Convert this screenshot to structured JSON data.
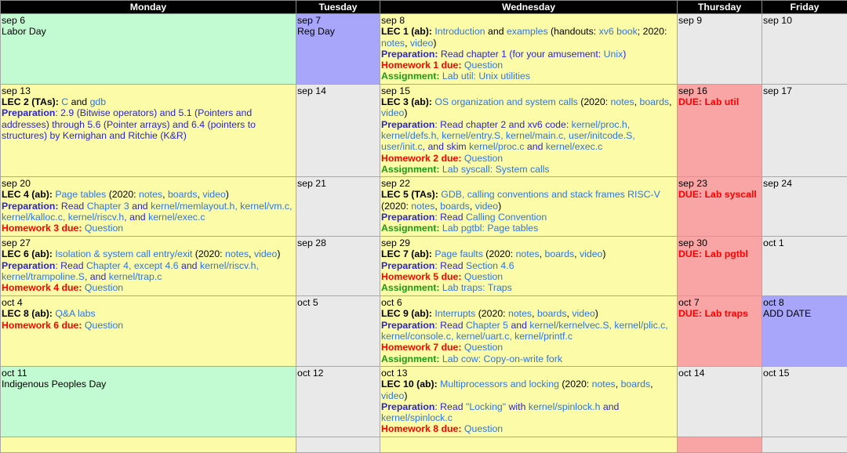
{
  "headers": [
    "Monday",
    "Tuesday",
    "Wednesday",
    "Thursday",
    "Friday"
  ],
  "weeks": [
    {
      "mon": {
        "date": "sep 6",
        "text": "Labor Day"
      },
      "tue": {
        "date": "sep 7",
        "text": "Reg Day"
      },
      "wed": {
        "date": "sep 8",
        "lec_label": "LEC 1 (ab):",
        "lec_link1": "Introduction",
        "lec_and": "and",
        "lec_link2": "examples",
        "lec_mid": "(handouts:",
        "lec_link3": "xv6 book",
        "lec_mid2": "; 2020:",
        "lec_link4": "notes",
        "lec_link5": "video",
        "lec_close": ")",
        "prep_label": "Preparation:",
        "prep_text": "Read chapter 1 (for your amusement:",
        "prep_link": "Unix",
        "prep_close": ")",
        "hw_label": "Homework 1 due:",
        "hw_link": "Question",
        "asg_label": "Assignment:",
        "asg_link": "Lab util: Unix utilities"
      },
      "thu": {
        "date": "sep 9"
      },
      "fri": {
        "date": "sep 10"
      }
    },
    {
      "mon": {
        "date": "sep 13",
        "lec_label": "LEC 2 (TAs):",
        "lec_link1": "C",
        "lec_and": "and",
        "lec_link2": "gdb",
        "prep_label": "Preparation",
        "prep_text": ": 2.9 (Bitwise operators) and 5.1 (Pointers and addresses) through 5.6 (Pointer arrays) and 6.4 (pointers to structures) by Kernighan and Ritchie (K&R)"
      },
      "tue": {
        "date": "sep 14"
      },
      "wed": {
        "date": "sep 15",
        "lec_label": "LEC 3 (ab):",
        "lec_link1": "OS organization and system calls",
        "lec_mid": "(2020:",
        "lec_link2": "notes",
        "lec_link3": "boards",
        "lec_link4": "video",
        "lec_close": ")",
        "prep_label": "Preparation",
        "prep_text": ": Read chapter 2 and xv6 code:",
        "prep_files": "kernel/proc.h, kernel/defs.h, kernel/entry.S, kernel/main.c, user/initcode.S, user/init.c",
        "prep_and_skim": ", and skim",
        "prep_file2": "kernel/proc.c",
        "prep_and": "and",
        "prep_file3": "kernel/exec.c",
        "hw_label": "Homework 2 due:",
        "hw_link": "Question",
        "asg_label": "Assignment:",
        "asg_link": "Lab syscall: System calls"
      },
      "thu": {
        "date": "sep 16",
        "due_label": "DUE:",
        "due_link": "Lab util"
      },
      "fri": {
        "date": "sep 17"
      }
    },
    {
      "mon": {
        "date": "sep 20",
        "lec_label": "LEC 4 (ab):",
        "lec_link1": "Page tables",
        "lec_mid": "(2020:",
        "lec_link2": "notes",
        "lec_link3": "boards",
        "lec_link4": "video",
        "lec_close": ")",
        "prep_label": "Preparation:",
        "prep_text": "Read",
        "prep_link1": "Chapter 3",
        "prep_and": "and",
        "prep_files": "kernel/memlayout.h, kernel/vm.c, kernel/kalloc.c, kernel/riscv.h",
        "prep_and2": ", and",
        "prep_file2": "kernel/exec.c",
        "hw_label": "Homework 3 due:",
        "hw_link": "Question"
      },
      "tue": {
        "date": "sep 21"
      },
      "wed": {
        "date": "sep 22",
        "lec_label": "LEC 5 (TAs):",
        "lec_link1": "GDB, calling conventions and stack frames RISC-V",
        "lec_mid": "(2020:",
        "lec_link2": "notes",
        "lec_link3": "boards",
        "lec_link4": "video",
        "lec_close": ")",
        "prep_label": "Preparation",
        "prep_text": ": Read",
        "prep_link": "Calling Convention",
        "asg_label": "Assignment:",
        "asg_link": "Lab pgtbl: Page tables"
      },
      "thu": {
        "date": "sep 23",
        "due_label": "DUE:",
        "due_link": "Lab syscall"
      },
      "fri": {
        "date": "sep 24"
      }
    },
    {
      "mon": {
        "date": "sep 27",
        "lec_label": "LEC 6 (ab):",
        "lec_link1": "Isolation & system call entry/exit",
        "lec_mid": "(2020:",
        "lec_link2": "notes",
        "lec_link3": "video",
        "lec_close": ")",
        "prep_label": "Preparation",
        "prep_text": ": Read",
        "prep_link1": "Chapter 4, except 4.6",
        "prep_and": "and",
        "prep_files": "kernel/riscv.h, kernel/trampoline.S",
        "prep_and2": ", and",
        "prep_file2": "kernel/trap.c",
        "hw_label": "Homework 4 due:",
        "hw_link": "Question"
      },
      "tue": {
        "date": "sep 28"
      },
      "wed": {
        "date": "sep 29",
        "lec_label": "LEC 7 (ab):",
        "lec_link1": "Page faults",
        "lec_mid": "(2020:",
        "lec_link2": "notes",
        "lec_link3": "boards",
        "lec_link4": "video",
        "lec_close": ")",
        "prep_label": "Preparation",
        "prep_text": ": Read",
        "prep_link": "Section 4.6",
        "hw_label": "Homework 5 due:",
        "hw_link": "Question",
        "asg_label": "Assignment:",
        "asg_link": "Lab traps: Traps"
      },
      "thu": {
        "date": "sep 30",
        "due_label": "DUE:",
        "due_link": "Lab pgtbl"
      },
      "fri": {
        "date": "oct 1"
      }
    },
    {
      "mon": {
        "date": "oct 4",
        "lec_label": "LEC 8 (ab):",
        "lec_link1": "Q&A labs",
        "hw_label": "Homework 6 due:",
        "hw_link": "Question"
      },
      "tue": {
        "date": "oct 5"
      },
      "wed": {
        "date": "oct 6",
        "lec_label": "LEC 9 (ab):",
        "lec_link1": "Interrupts",
        "lec_mid": "(2020:",
        "lec_link2": "notes",
        "lec_link3": "boards",
        "lec_link4": "video",
        "lec_close": ")",
        "prep_label": "Preparation",
        "prep_text": ": Read",
        "prep_link1": "Chapter 5",
        "prep_and": "and",
        "prep_files": "kernel/kernelvec.S, kernel/plic.c, kernel/console.c, kernel/uart.c, kernel/printf.c",
        "hw_label": "Homework 7 due:",
        "hw_link": "Question",
        "asg_label": "Assignment:",
        "asg_link": "Lab cow: Copy-on-write fork"
      },
      "thu": {
        "date": "oct 7",
        "due_label": "DUE:",
        "due_link": "Lab traps"
      },
      "fri": {
        "date": "oct 8",
        "text": "ADD DATE"
      }
    },
    {
      "mon": {
        "date": "oct 11",
        "text": "Indigenous Peoples Day"
      },
      "tue": {
        "date": "oct 12"
      },
      "wed": {
        "date": "oct 13",
        "lec_label": "LEC 10 (ab):",
        "lec_link1": "Multiprocessors and locking",
        "lec_mid": "(2020:",
        "lec_link2": "notes",
        "lec_link3": "boards",
        "lec_link4": "video",
        "lec_close": ")",
        "prep_label": "Preparation",
        "prep_text": ": Read",
        "prep_link": "\"Locking\"",
        "prep_with": "with",
        "prep_file1": "kernel/spinlock.h",
        "prep_and": "and",
        "prep_file2": "kernel/spinlock.c",
        "hw_label": "Homework 8 due:",
        "hw_link": "Question"
      },
      "thu": {
        "date": "oct 14"
      },
      "fri": {
        "date": "oct 15"
      }
    }
  ],
  "colors": {
    "holiday": "#c2fbd2",
    "lecture": "#fbfba8",
    "regday": "#a7a6fa",
    "empty": "#e9e9e9",
    "due": "#faa5a5",
    "link": "#2e75e6",
    "preparation": "#2c24d4",
    "homework": "#ff0000",
    "assignment": "#1b9a13"
  }
}
